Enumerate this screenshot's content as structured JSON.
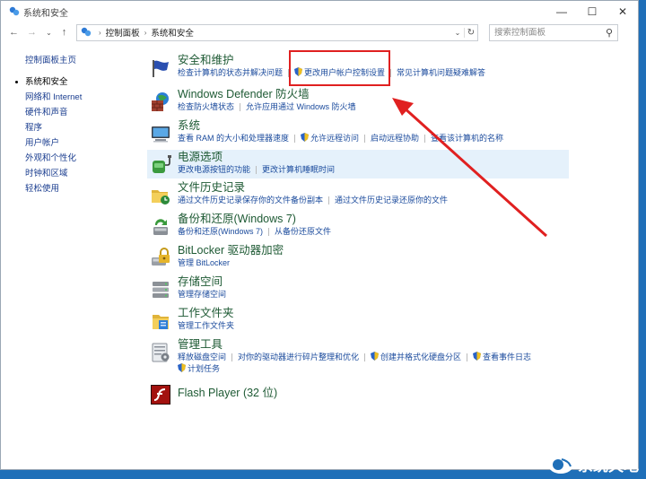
{
  "window": {
    "title": "系统和安全",
    "controls": {
      "minimize": "—",
      "maximize": "☐",
      "close": "✕"
    }
  },
  "nav": {
    "back": "←",
    "forward": "→",
    "recent": "⌄",
    "up": "↑"
  },
  "address": {
    "crumbs": [
      "控制面板",
      "系统和安全"
    ],
    "separator": "›",
    "dropdown": "⌄",
    "refresh": "↻"
  },
  "search": {
    "placeholder": "搜索控制面板",
    "icon": "search-icon"
  },
  "sidebar": {
    "home": "控制面板主页",
    "items": [
      "系统和安全",
      "网络和 Internet",
      "硬件和声音",
      "程序",
      "用户帐户",
      "外观和个性化",
      "时钟和区域",
      "轻松使用"
    ],
    "current": "系统和安全"
  },
  "categories": [
    {
      "title": "安全和维护",
      "icon": "flag-icon",
      "links": [
        {
          "text": "检查计算机的状态并解决问题",
          "shield": false
        },
        {
          "text": "更改用户帐户控制设置",
          "shield": true
        },
        {
          "text": "常见计算机问题疑难解答",
          "shield": false
        }
      ]
    },
    {
      "title": "Windows Defender 防火墙",
      "icon": "firewall-icon",
      "links": [
        {
          "text": "检查防火墙状态",
          "shield": false
        },
        {
          "text": "允许应用通过 Windows 防火墙",
          "shield": false
        }
      ]
    },
    {
      "title": "系统",
      "icon": "system-icon",
      "links": [
        {
          "text": "查看 RAM 的大小和处理器速度",
          "shield": false
        },
        {
          "text": "允许远程访问",
          "shield": true
        },
        {
          "text": "启动远程协助",
          "shield": false
        },
        {
          "text": "查看该计算机的名称",
          "shield": false
        }
      ]
    },
    {
      "title": "电源选项",
      "icon": "power-icon",
      "links": [
        {
          "text": "更改电源按钮的功能",
          "shield": false
        },
        {
          "text": "更改计算机睡眠时间",
          "shield": false
        }
      ]
    },
    {
      "title": "文件历史记录",
      "icon": "file-history-icon",
      "links": [
        {
          "text": "通过文件历史记录保存你的文件备份副本",
          "shield": false
        },
        {
          "text": "通过文件历史记录还原你的文件",
          "shield": false
        }
      ]
    },
    {
      "title": "备份和还原(Windows 7)",
      "icon": "backup-icon",
      "links": [
        {
          "text": "备份和还原(Windows 7)",
          "shield": false
        },
        {
          "text": "从备份还原文件",
          "shield": false
        }
      ]
    },
    {
      "title": "BitLocker 驱动器加密",
      "icon": "bitlocker-icon",
      "links": [
        {
          "text": "管理 BitLocker",
          "shield": false
        }
      ]
    },
    {
      "title": "存储空间",
      "icon": "storage-icon",
      "links": [
        {
          "text": "管理存储空间",
          "shield": false
        }
      ]
    },
    {
      "title": "工作文件夹",
      "icon": "work-folder-icon",
      "links": [
        {
          "text": "管理工作文件夹",
          "shield": false
        }
      ]
    },
    {
      "title": "管理工具",
      "icon": "admin-tools-icon",
      "links": [
        {
          "text": "释放磁盘空间",
          "shield": false
        },
        {
          "text": "对你的驱动器进行碎片整理和优化",
          "shield": false
        },
        {
          "text": "创建并格式化硬盘分区",
          "shield": true
        },
        {
          "text": "查看事件日志",
          "shield": true
        },
        {
          "text": "计划任务",
          "shield": true
        }
      ]
    },
    {
      "title": "Flash Player (32 位)",
      "icon": "flash-icon",
      "links": []
    }
  ],
  "annotation": {
    "color": "#e02020"
  },
  "watermark": {
    "text": "系统天地"
  },
  "colors": {
    "link": "#1a4a9c",
    "title": "#1e5a34",
    "highlight": "#e5f1fb",
    "background": "#1f6fb8"
  }
}
